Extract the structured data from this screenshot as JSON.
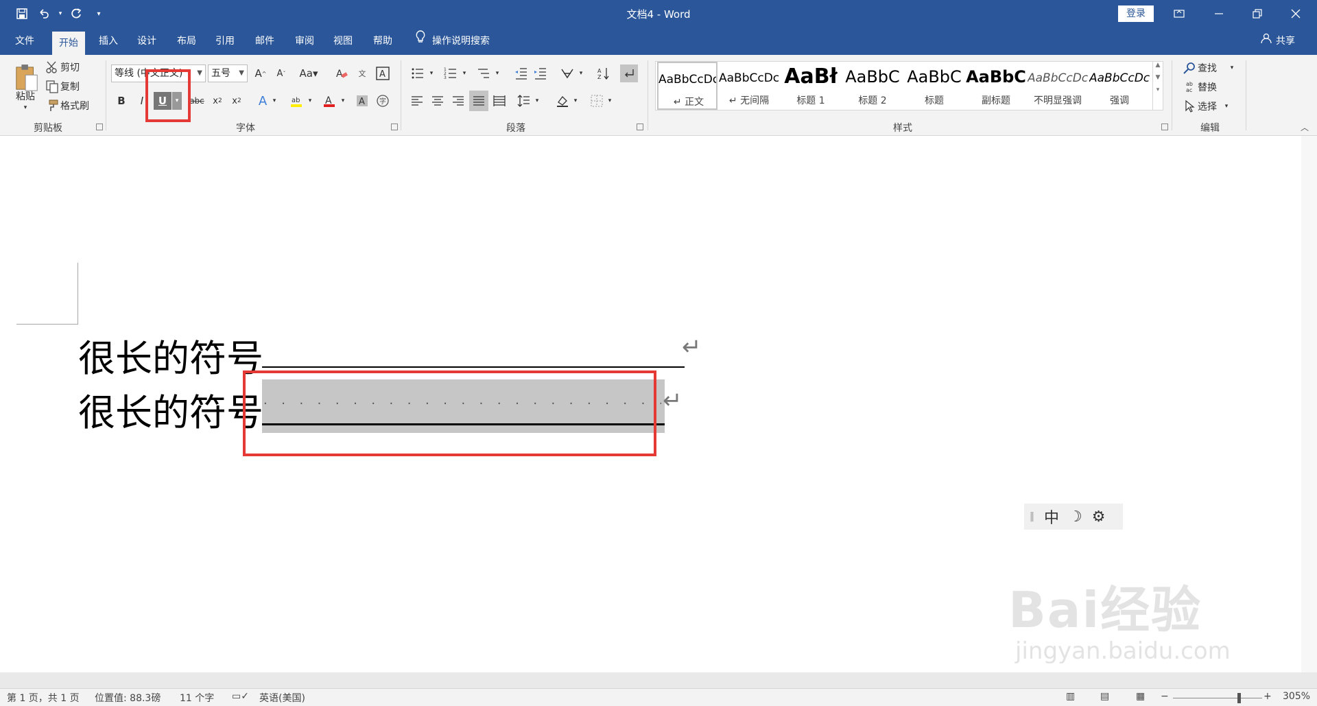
{
  "titlebar": {
    "title": "文档4  -  Word",
    "login_label": "登录"
  },
  "tabs": [
    {
      "label": "文件"
    },
    {
      "label": "开始"
    },
    {
      "label": "插入"
    },
    {
      "label": "设计"
    },
    {
      "label": "布局"
    },
    {
      "label": "引用"
    },
    {
      "label": "邮件"
    },
    {
      "label": "审阅"
    },
    {
      "label": "视图"
    },
    {
      "label": "帮助"
    }
  ],
  "tell_me": "操作说明搜索",
  "share": "共享",
  "ribbon": {
    "clipboard": {
      "paste_label": "粘贴",
      "cut_label": "剪切",
      "copy_label": "复制",
      "format_painter_label": "格式刷",
      "group_label": "剪贴板"
    },
    "font": {
      "font_name": "等线 (中文正文)",
      "font_size": "五号",
      "bold": "B",
      "italic": "I",
      "underline": "U",
      "strikethrough": "abc",
      "group_label": "字体"
    },
    "paragraph": {
      "group_label": "段落"
    },
    "styles": {
      "group_label": "样式",
      "items": [
        {
          "sample": "AaBbCcDc",
          "name": "↵ 正文"
        },
        {
          "sample": "AaBbCcDc",
          "name": "↵ 无间隔"
        },
        {
          "sample": "AaBł",
          "name": "标题 1"
        },
        {
          "sample": "AaBbC",
          "name": "标题 2"
        },
        {
          "sample": "AaBbC",
          "name": "标题"
        },
        {
          "sample": "AaBbC",
          "name": "副标题"
        },
        {
          "sample": "AaBbCcDc",
          "name": "不明显强调"
        },
        {
          "sample": "AaBbCcDc",
          "name": "强调"
        }
      ]
    },
    "editing": {
      "find_label": "查找",
      "replace_label": "替换",
      "select_label": "选择",
      "group_label": "编辑"
    }
  },
  "document": {
    "line1": "很长的符号",
    "line2": "很长的符号",
    "dots": "·······················"
  },
  "ime": {
    "mode": "中"
  },
  "watermark": {
    "big": "Bai经验",
    "small": "jingyan.baidu.com"
  },
  "statusbar": {
    "page": "第 1 页，共 1 页",
    "position": "位置值: 88.3磅",
    "words": "11 个字",
    "language": "英语(美国)",
    "zoom": "305%"
  },
  "colors": {
    "title_bar": "#2b579a",
    "highlight_box": "#e53935",
    "selection": "#c6c6c6"
  }
}
